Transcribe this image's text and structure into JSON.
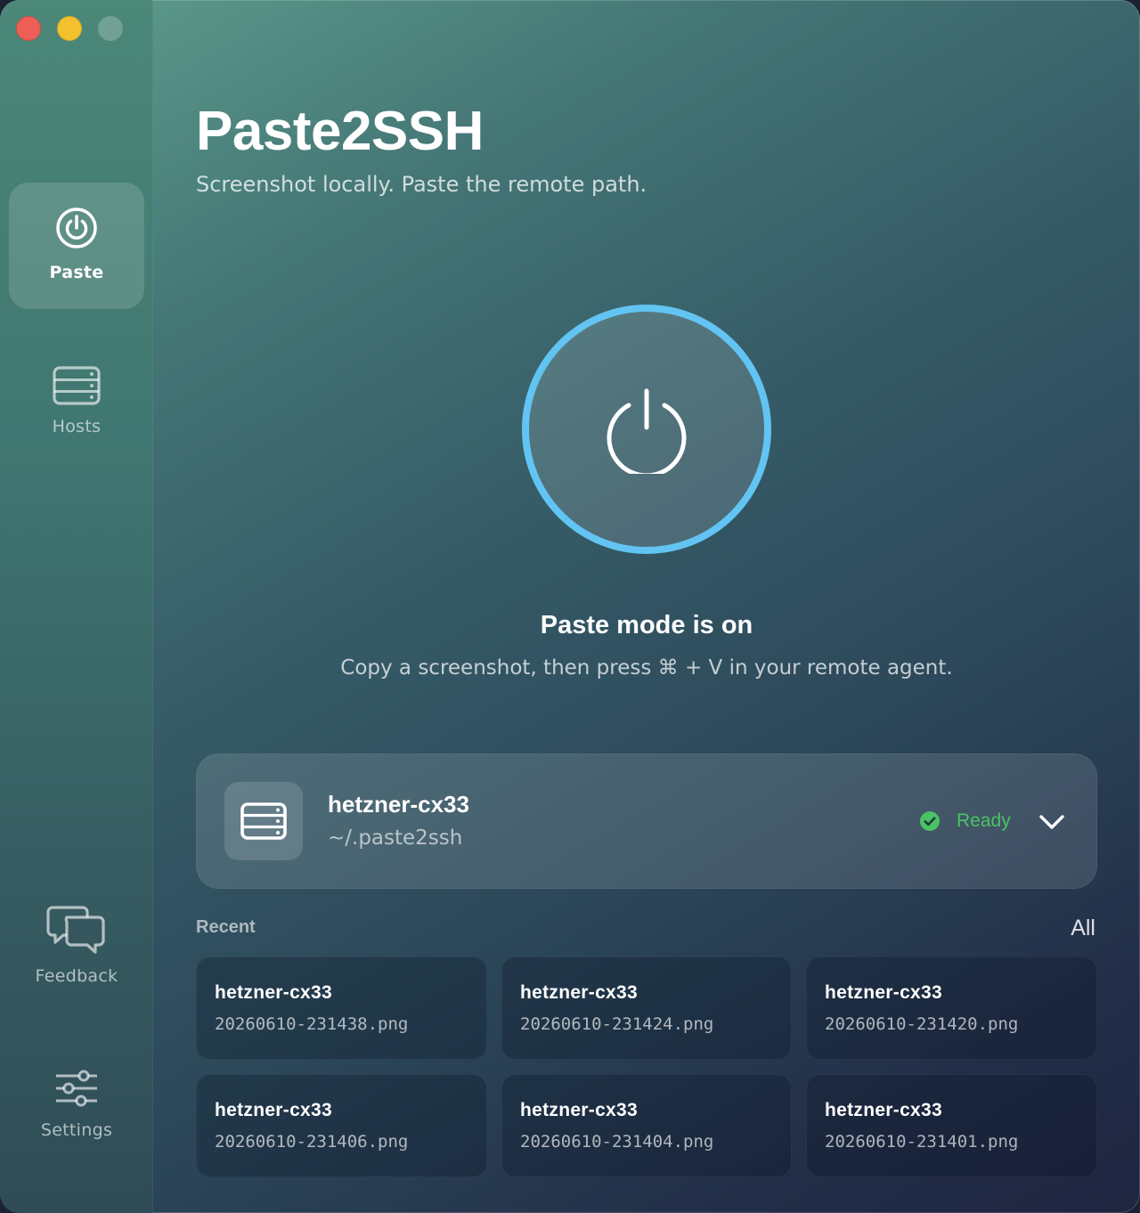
{
  "app": {
    "title": "Paste2SSH",
    "subtitle": "Screenshot locally. Paste the remote path."
  },
  "sidebar": {
    "items": [
      {
        "label": "Paste",
        "icon": "power-icon",
        "active": true
      },
      {
        "label": "Hosts",
        "icon": "server-icon",
        "active": false
      },
      {
        "label": "Feedback",
        "icon": "chat-bubbles-icon",
        "active": false
      },
      {
        "label": "Settings",
        "icon": "sliders-icon",
        "active": false
      }
    ]
  },
  "main": {
    "mode_title": "Paste mode is on",
    "mode_subtitle": "Copy a screenshot, then press ⌘ + V in your remote agent."
  },
  "host": {
    "name": "hetzner-cx33",
    "path": "~/.paste2ssh",
    "status": "Ready",
    "status_color": "#49c463"
  },
  "recent": {
    "label": "Recent",
    "all_label": "All",
    "items": [
      {
        "host": "hetzner-cx33",
        "file": "20260610-231438.png"
      },
      {
        "host": "hetzner-cx33",
        "file": "20260610-231424.png"
      },
      {
        "host": "hetzner-cx33",
        "file": "20260610-231420.png"
      },
      {
        "host": "hetzner-cx33",
        "file": "20260610-231406.png"
      },
      {
        "host": "hetzner-cx33",
        "file": "20260610-231404.png"
      },
      {
        "host": "hetzner-cx33",
        "file": "20260610-231401.png"
      }
    ]
  },
  "colors": {
    "accent_ring": "#62c4f2",
    "close": "#ee5f57",
    "minimize": "#f4c12e"
  }
}
